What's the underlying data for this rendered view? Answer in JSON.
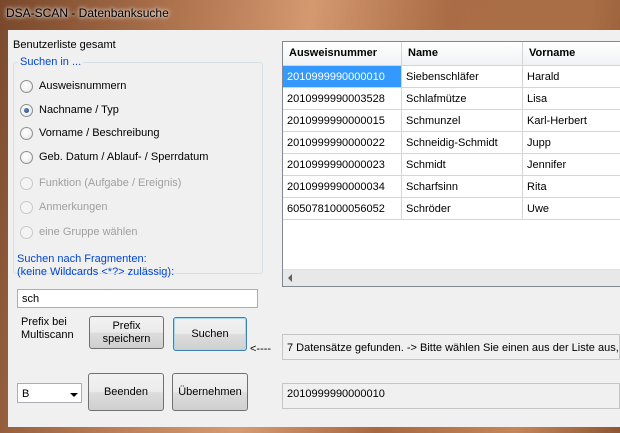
{
  "window": {
    "title": "DSA-SCAN - Datenbanksuche"
  },
  "left": {
    "header": "Benutzerliste gesamt",
    "group_title": "Suchen in ...",
    "radios": [
      {
        "label": "Ausweisnummern",
        "checked": false,
        "disabled": false
      },
      {
        "label": "Nachname / Typ",
        "checked": true,
        "disabled": false
      },
      {
        "label": "Vorname / Beschreibung",
        "checked": false,
        "disabled": false
      },
      {
        "label": "Geb. Datum / Ablauf- / Sperrdatum",
        "checked": false,
        "disabled": false
      },
      {
        "label": "Funktion (Aufgabe / Ereignis)",
        "checked": false,
        "disabled": true
      },
      {
        "label": "Anmerkungen",
        "checked": false,
        "disabled": true
      },
      {
        "label": "eine Gruppe wählen",
        "checked": false,
        "disabled": true
      }
    ],
    "fragments_label_1": "Suchen nach Fragmenten:",
    "fragments_label_2": "(keine Wildcards <*?> zulässig):",
    "search_value": "sch",
    "prefix_label_1": "Prefix bei",
    "prefix_label_2": "Multiscann",
    "prefix_save_1": "Prefix",
    "prefix_save_2": "speichern",
    "search_button": "Suchen",
    "select_value": "B",
    "close_button": "Beenden",
    "accept_button": "Übernehmen"
  },
  "grid": {
    "columns": [
      "Ausweisnummer",
      "Name",
      "Vorname"
    ],
    "rows": [
      [
        "2010999990000010",
        "Siebenschläfer",
        "Harald"
      ],
      [
        "2010999990003528",
        "Schlafmütze",
        "Lisa"
      ],
      [
        "2010999990000015",
        "Schmunzel",
        "Karl-Herbert"
      ],
      [
        "2010999990000022",
        "Schneidig-Schmidt",
        "Jupp"
      ],
      [
        "2010999990000023",
        "Schmidt",
        "Jennifer"
      ],
      [
        "2010999990000034",
        "Scharfsinn",
        "Rita"
      ],
      [
        "6050781000056052",
        "Schröder",
        "Uwe"
      ]
    ],
    "selected_row": 0
  },
  "status": {
    "arrow": "<----",
    "message": "7 Datensätze gefunden. -> Bitte wählen Sie einen aus der Liste aus, um",
    "selected_id": "2010999990000010"
  },
  "colors": {
    "accent": "#0046d5",
    "selection": "#3399ff"
  }
}
